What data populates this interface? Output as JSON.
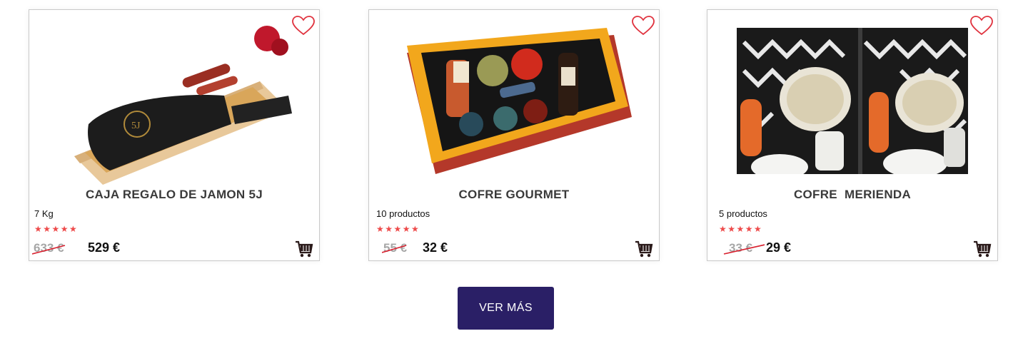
{
  "accent_color": "#2a1f66",
  "heart_color": "#e0333f",
  "star_color": "#ee4a4a",
  "products": [
    {
      "title": "CAJA REGALO DE JAMON 5J",
      "subtitle": "7 Kg",
      "rating": "★★★★★",
      "old_price": "633 €",
      "price": "529 €",
      "image_alt": "Caja regalo de jamón 5J"
    },
    {
      "title": "COFRE GOURMET",
      "subtitle": "10 productos",
      "rating": "★★★★★",
      "old_price": "55 €",
      "price": "32 €",
      "image_alt": "Cofre gourmet"
    },
    {
      "title": "COFRE  MERIENDA",
      "subtitle": "5 productos",
      "rating": "★★★★★",
      "old_price": "33 €",
      "price": "29 €",
      "image_alt": "Cofre merienda"
    }
  ],
  "ver_mas_label": "VER MÁS"
}
